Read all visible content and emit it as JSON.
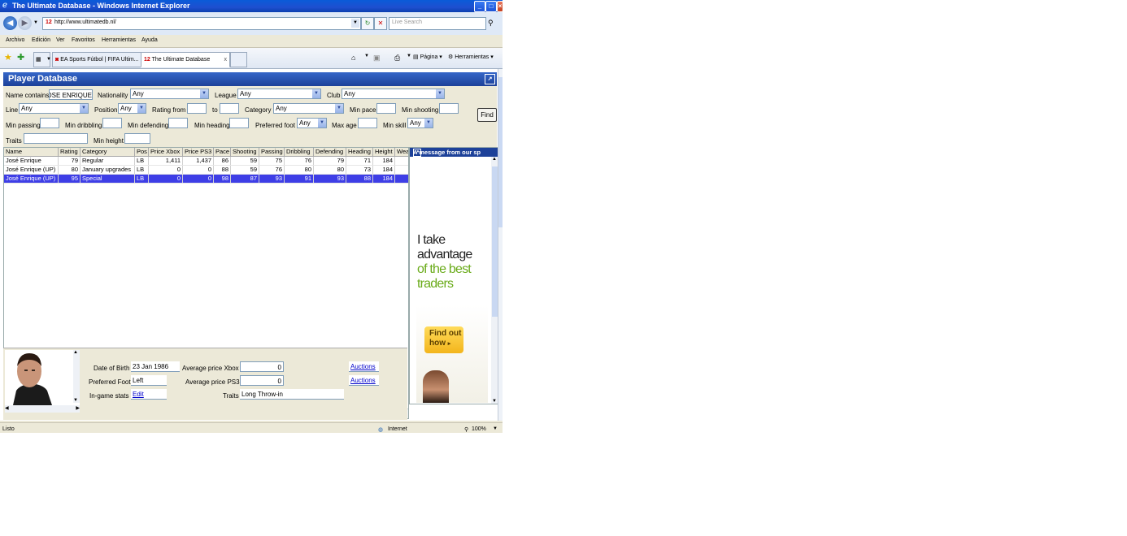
{
  "window": {
    "title": "The Ultimate Database - Windows Internet Explorer"
  },
  "address": {
    "url": "http://www.ultimatedb.nl/",
    "favicon": "12"
  },
  "search": {
    "placeholder": "Live Search"
  },
  "menu": [
    "Archivo",
    "Edición",
    "Ver",
    "Favoritos",
    "Herramientas",
    "Ayuda"
  ],
  "tabs": [
    {
      "label": "EA Sports Fútbol | FIFA Ultim..."
    },
    {
      "label": "The Ultimate Database"
    }
  ],
  "toolbar": {
    "page_label": "Página",
    "tools_label": "Herramientas"
  },
  "panel": {
    "title": "Player Database"
  },
  "filters": {
    "name_label": "Name contains",
    "name_value": "OSE ENRIQUE",
    "nationality_label": "Nationality",
    "nationality_value": "Any",
    "league_label": "League",
    "league_value": "Any",
    "club_label": "Club",
    "club_value": "Any",
    "line_label": "Line",
    "line_value": "Any",
    "position_label": "Position",
    "position_value": "Any",
    "rating_from_label": "Rating from",
    "rating_to_label": "to",
    "category_label": "Category",
    "category_value": "Any",
    "min_pace_label": "Min pace",
    "min_shooting_label": "Min shooting",
    "find_label": "Find",
    "min_passing_label": "Min passing",
    "min_dribbling_label": "Min dribbling",
    "min_defending_label": "Min defending",
    "min_heading_label": "Min heading",
    "preferred_foot_label": "Preferred foot",
    "preferred_foot_value": "Any",
    "max_age_label": "Max age",
    "min_skill_label": "Min skill",
    "min_skill_value": "Any",
    "traits_label": "Traits",
    "min_height_label": "Min height"
  },
  "grid": {
    "columns": [
      "Name",
      "Rating",
      "Category",
      "Pos",
      "Price Xbox",
      "Price PS3",
      "Pace",
      "Shooting",
      "Passing",
      "Dribbling",
      "Defending",
      "Heading",
      "Height",
      "Wea"
    ],
    "rows": [
      [
        "José Enrique",
        "79",
        "Regular",
        "LB",
        "1,411",
        "1,437",
        "86",
        "59",
        "75",
        "76",
        "79",
        "71",
        "184",
        ""
      ],
      [
        "José Enrique (UP)",
        "80",
        "January upgrades",
        "LB",
        "0",
        "0",
        "88",
        "59",
        "76",
        "80",
        "80",
        "73",
        "184",
        ""
      ],
      [
        "José Enrique (UP)",
        "95",
        "Special",
        "LB",
        "0",
        "0",
        "98",
        "87",
        "93",
        "91",
        "93",
        "88",
        "184",
        ""
      ]
    ],
    "selected_row": 2
  },
  "detail": {
    "dob_label": "Date of Birth",
    "dob_value": "23 Jan 1986",
    "avg_xbox_label": "Average price Xbox",
    "avg_xbox_value": "0",
    "auctions_label": "Auctions",
    "foot_label": "Preferred Foot",
    "foot_value": "Left",
    "avg_ps3_label": "Average price PS3",
    "avg_ps3_value": "0",
    "ingame_label": "In-game stats",
    "ingame_link": "Edit",
    "traits_label": "Traits",
    "traits_value": "Long Throw-in"
  },
  "ad": {
    "header": "A message from our sp",
    "line1": "I take",
    "line2": "advantage",
    "line3": "of the best",
    "line4": "traders",
    "button_line1": "Find out",
    "button_line2": "how"
  },
  "status": {
    "left": "Listo",
    "zone": "Internet",
    "zoom": "100%"
  }
}
